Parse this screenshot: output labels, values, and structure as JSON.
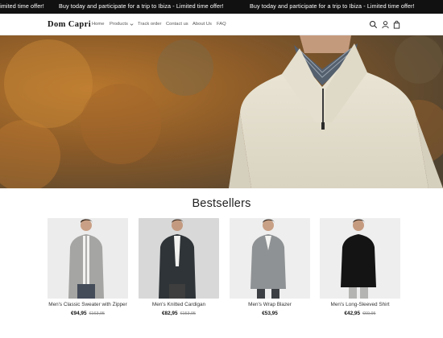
{
  "announcement": {
    "messages": [
      "Limited time offer!",
      "Buy today and participate for a trip to Ibiza - Limited time offer!",
      "Buy today and participate for a trip to Ibiza - Limited time offer!"
    ]
  },
  "header": {
    "logo": "Dom Capri",
    "nav": [
      "Home",
      "Products",
      "Track order",
      "Contact us",
      "About Us",
      "FAQ"
    ],
    "icons": [
      "search-icon",
      "account-icon",
      "cart-icon"
    ]
  },
  "section": {
    "title": "Bestsellers"
  },
  "products": [
    {
      "name": "Men's Classic Sweater with Zipper",
      "price": "€94,95",
      "compare_price": "€163,95"
    },
    {
      "name": "Men's Knitted Cardigan",
      "price": "€82,95",
      "compare_price": "€153,95"
    },
    {
      "name": "Men's Wrap Blazer",
      "price": "€53,95",
      "compare_price": ""
    },
    {
      "name": "Men's Long-Sleeved Shirt",
      "price": "€42,95",
      "compare_price": "€69,95"
    }
  ]
}
